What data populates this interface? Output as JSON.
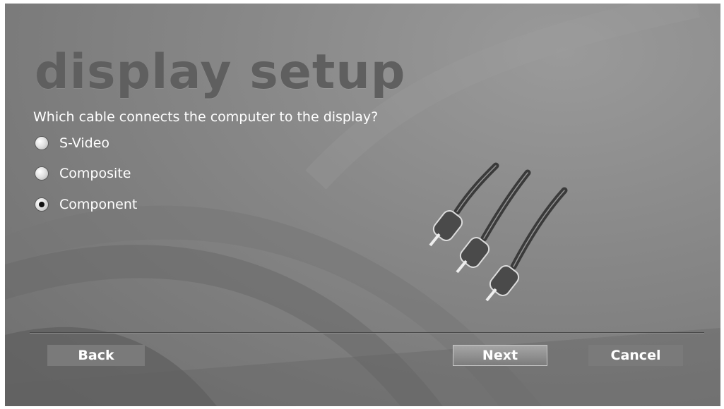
{
  "page_title": "display setup",
  "question": "Which cable connects the computer to the display?",
  "options": [
    {
      "label": "S-Video",
      "selected": false
    },
    {
      "label": "Composite",
      "selected": false
    },
    {
      "label": "Component",
      "selected": true
    }
  ],
  "buttons": {
    "back": "Back",
    "next": "Next",
    "cancel": "Cancel"
  },
  "illustration": "component-cable-icon"
}
